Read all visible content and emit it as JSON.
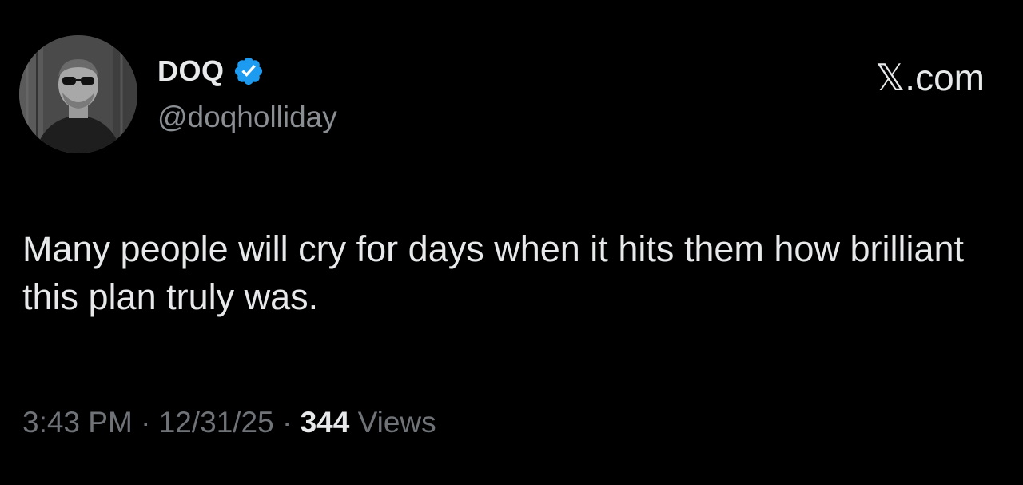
{
  "author": {
    "display_name": "DOQ",
    "handle": "@doqholliday",
    "verified": true,
    "verified_color": "#1d9bf0"
  },
  "brand": {
    "label": "𝕏.com"
  },
  "tweet": {
    "text": "Many people will cry for days when it hits them how brilliant this plan truly was."
  },
  "meta": {
    "time": "3:43 PM",
    "separator": "·",
    "date": "12/31/25",
    "views_count": "344",
    "views_label": "Views"
  },
  "colors": {
    "background": "#000000",
    "primary_text": "#e7e9ea",
    "secondary_text": "#8b8f94"
  }
}
